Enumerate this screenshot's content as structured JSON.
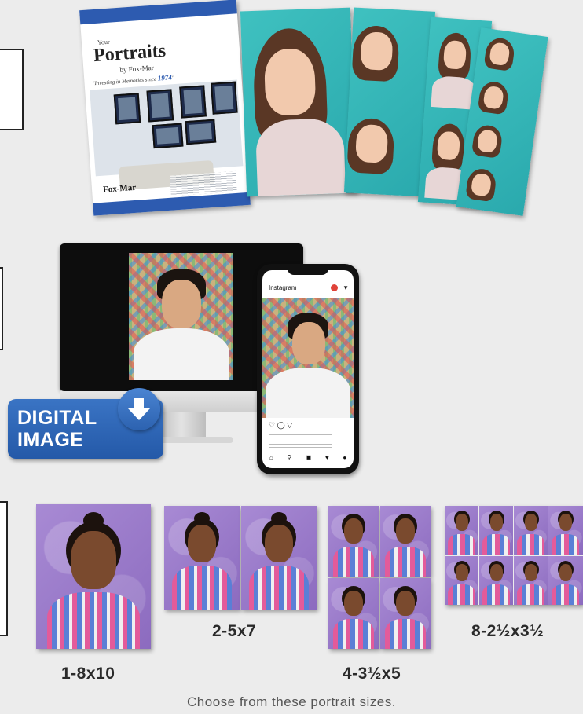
{
  "brochure": {
    "title_small": "Your",
    "title": "Portraits",
    "by_line": "by Fox-Mar",
    "tagline": "\"Investing in Memories since ",
    "tagline_year": "1974",
    "logo": "Fox-Mar"
  },
  "badge": {
    "line1": "DIGITAL",
    "line2": "IMAGE",
    "icon": "download-arrow-icon"
  },
  "phone": {
    "app_name": "Instagram"
  },
  "sizes": [
    {
      "label": "1-8x10"
    },
    {
      "label": "2-5x7"
    },
    {
      "label": "4-3½x5"
    },
    {
      "label": "8-2½x3½"
    }
  ],
  "caption": "Choose from these portrait sizes.",
  "colors": {
    "brochure_blue": "#2d5bb0",
    "teal": "#3fc1c0",
    "badge_blue": "#2459a8",
    "purple": "#9a7bc9"
  }
}
